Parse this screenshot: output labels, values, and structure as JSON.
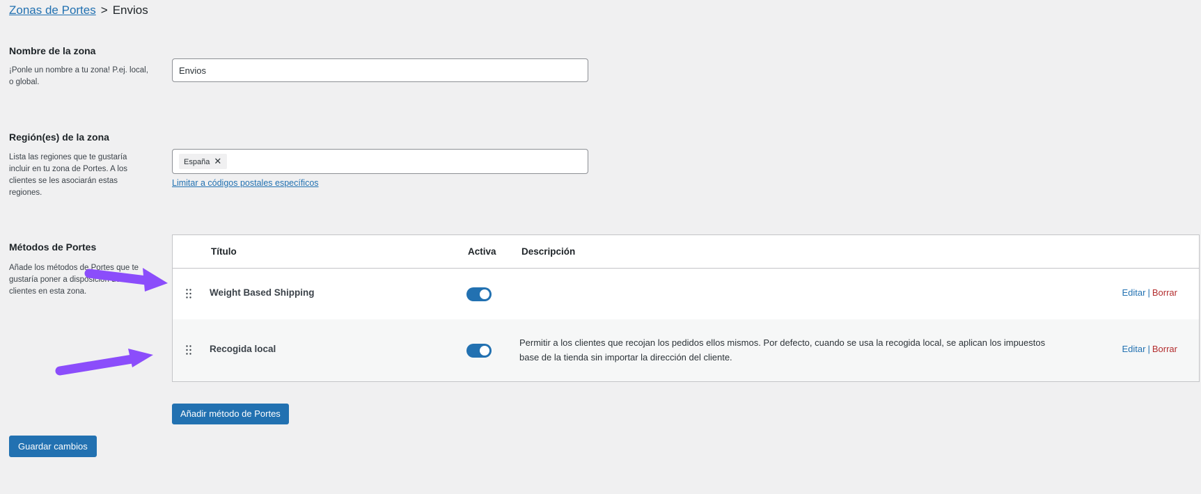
{
  "breadcrumb": {
    "parent": "Zonas de Portes",
    "separator": ">",
    "current": "Envios"
  },
  "zone_name": {
    "title": "Nombre de la zona",
    "description": "¡Ponle un nombre a tu zona! P.ej. local, o global.",
    "value": "Envios"
  },
  "zone_regions": {
    "title": "Región(es) de la zona",
    "description": "Lista las regiones que te gustaría incluir en tu zona de Portes. A los clientes se les asociarán estas regiones.",
    "chips": [
      "España"
    ],
    "remove_glyph": "✕",
    "postcode_link": "Limitar a códigos postales específicos"
  },
  "shipping_methods": {
    "title": "Métodos de Portes",
    "description": "Añade los métodos de Portes que te gustaría poner a disposición de los clientes en esta zona.",
    "columns": {
      "title": "Título",
      "enabled": "Activa",
      "description": "Descripción"
    },
    "rows": [
      {
        "title": "Weight Based Shipping",
        "enabled": true,
        "description": "",
        "edit": "Editar",
        "separator": "|",
        "delete": "Borrar"
      },
      {
        "title": "Recogida local",
        "enabled": true,
        "description": "Permitir a los clientes que recojan los pedidos ellos mismos. Por defecto, cuando se usa la recogida local, se aplican los impuestos base de la tienda sin importar la dirección del cliente.",
        "edit": "Editar",
        "separator": "|",
        "delete": "Borrar"
      }
    ],
    "add_button": "Añadir método de Portes"
  },
  "save_button": "Guardar cambios",
  "colors": {
    "accent": "#2271b1",
    "delete": "#b32d2e",
    "annotation_arrow": "#8b4dfb",
    "background": "#f0f0f1"
  },
  "icons": {
    "drag_handle": "drag-handle-icon",
    "annotation": "annotation-arrow-icon"
  }
}
